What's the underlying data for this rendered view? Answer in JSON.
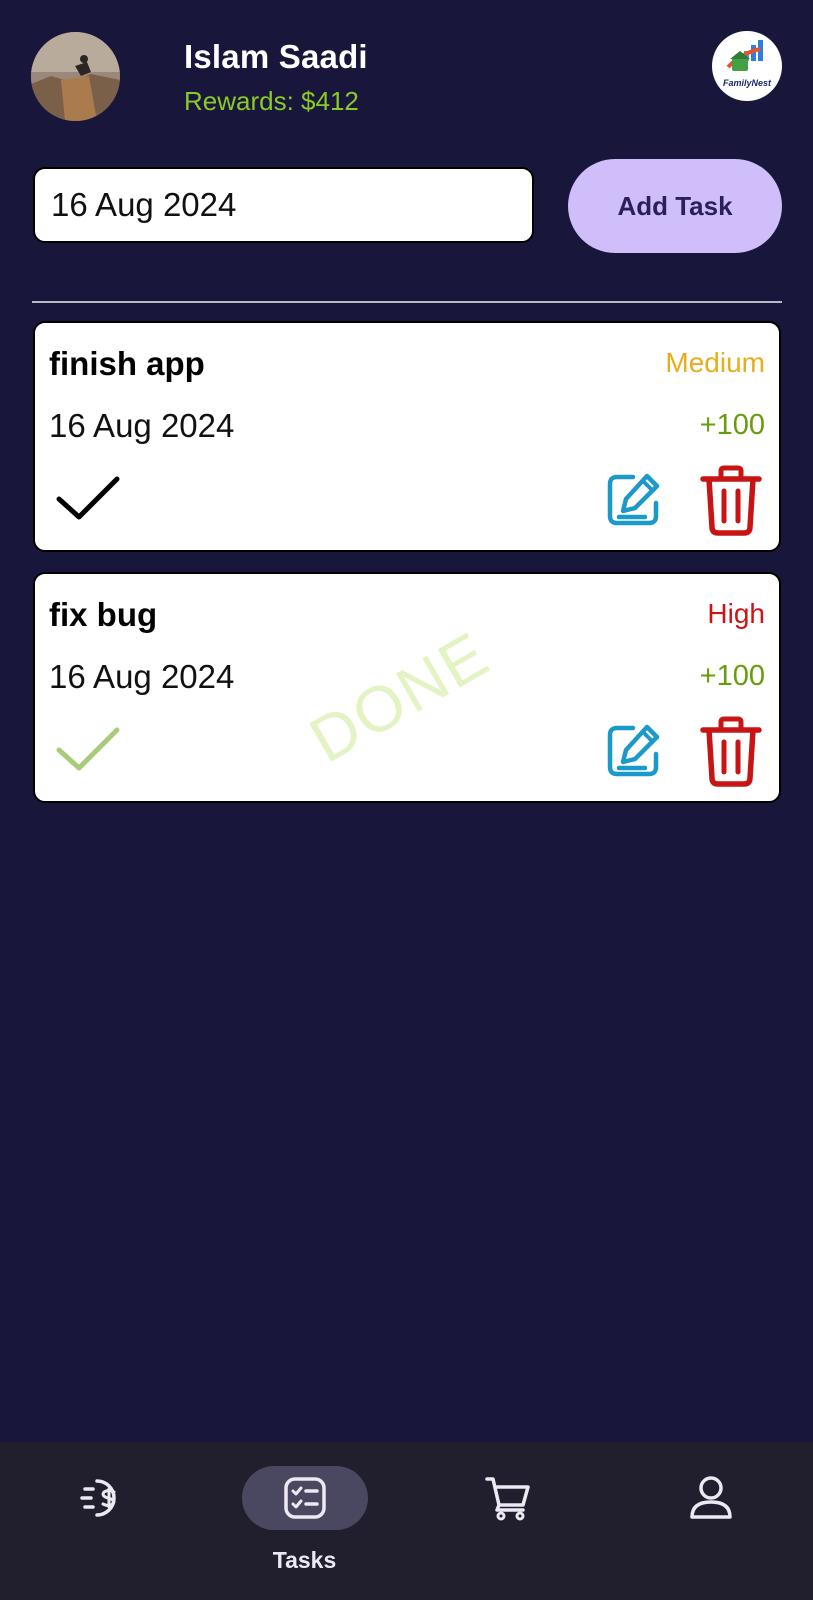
{
  "header": {
    "user_name": "Islam Saadi",
    "rewards": "Rewards: $412",
    "logo_text": "FamilyNest"
  },
  "task_form": {
    "date_value": "16 Aug 2024",
    "add_button_label": "Add Task"
  },
  "tasks": [
    {
      "title": "finish app",
      "priority": "Medium",
      "priority_color": "#e8ad1c",
      "date": "16 Aug 2024",
      "points": "+100",
      "done": false
    },
    {
      "title": "fix bug",
      "priority": "High",
      "priority_color": "#cc1414",
      "date": "16 Aug 2024",
      "points": "+100",
      "done": true,
      "done_label": "DONE"
    }
  ],
  "bottom_nav": {
    "items": [
      {
        "icon": "dollar-coin-icon",
        "label": ""
      },
      {
        "icon": "task-list-icon",
        "label": "Tasks",
        "active": true
      },
      {
        "icon": "cart-icon",
        "label": ""
      },
      {
        "icon": "user-icon",
        "label": ""
      }
    ]
  },
  "colors": {
    "background": "#19163b",
    "rewards": "#8ac926",
    "accent_button": "#cfbef9",
    "points": "#679c0d",
    "edit": "#1b9ac9",
    "delete": "#c81414",
    "check_done": "#a8cc7a"
  }
}
